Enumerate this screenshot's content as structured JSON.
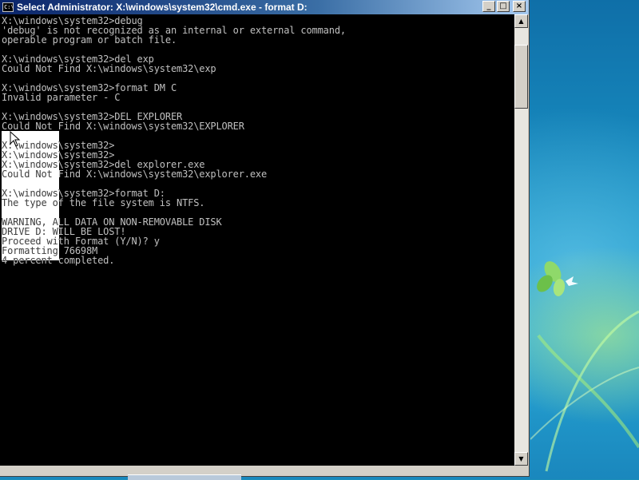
{
  "window": {
    "title": "Select Administrator: X:\\windows\\system32\\cmd.exe - format  D:",
    "icon": "cmd-icon",
    "icon_text": "C:\\",
    "buttons": {
      "minimize": "_",
      "maximize": "□",
      "close": "×"
    }
  },
  "console": {
    "lines": [
      "X:\\windows\\system32>debug",
      "'debug' is not recognized as an internal or external command,",
      "operable program or batch file.",
      "",
      "X:\\windows\\system32>del exp",
      "Could Not Find X:\\windows\\system32\\exp",
      "",
      "X:\\windows\\system32>format DM C",
      "Invalid parameter - C",
      "",
      "X:\\windows\\system32>DEL EXPLORER",
      "Could Not Find X:\\windows\\system32\\EXPLORER",
      "",
      "X:\\windows\\system32>",
      "X:\\windows\\system32>",
      "X:\\windows\\system32>del explorer.exe",
      "Could Not Find X:\\windows\\system32\\explorer.exe",
      "",
      "X:\\windows\\system32>format D:",
      "The type of the file system is NTFS.",
      "",
      "WARNING, ALL DATA ON NON-REMOVABLE DISK",
      "DRIVE D: WILL BE LOST!",
      "Proceed with Format (Y/N)? y",
      "Formatting 76698M",
      "4 percent completed."
    ]
  },
  "colors": {
    "console_bg": "#000000",
    "console_text": "#c0c0c0",
    "titlebar_start": "#0a246a",
    "titlebar_end": "#a6caf0"
  }
}
